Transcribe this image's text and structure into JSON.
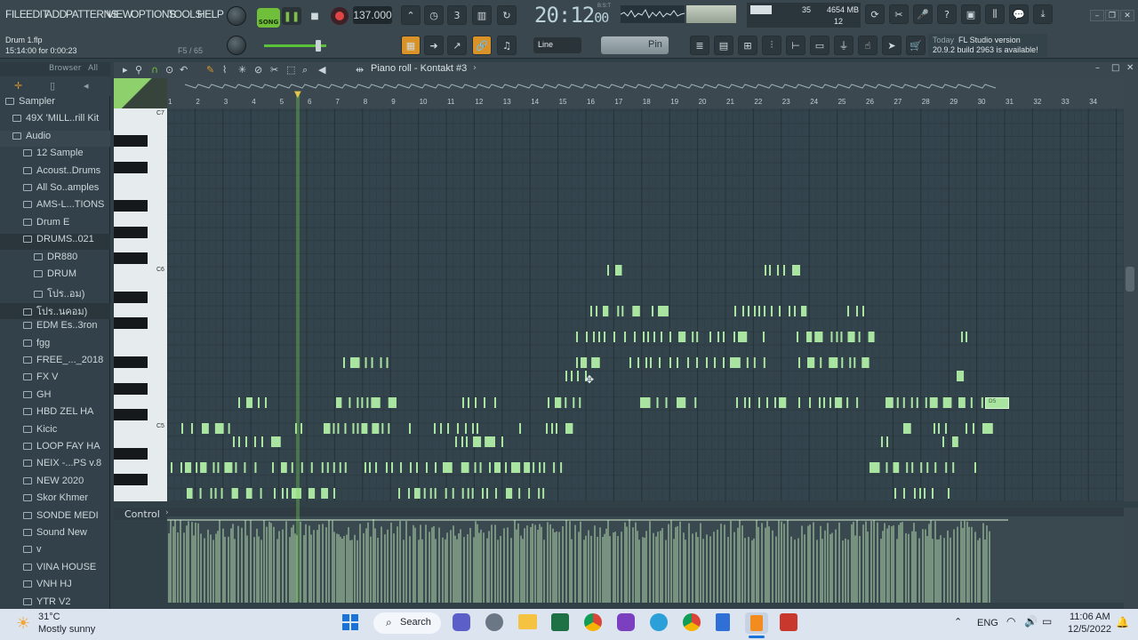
{
  "menu": [
    "FILE",
    "EDIT",
    "ADD",
    "PATTERNS",
    "VIEW",
    "OPTIONS",
    "TOOLS",
    "HELP"
  ],
  "project": {
    "file": "Drum 1.flp",
    "position": "15:14:00 for 0:00:23",
    "hint_right": "F5 / 65"
  },
  "transport": {
    "mode": "SONG",
    "tempo": "137.000",
    "clock": "20:12",
    "clock_small": "00",
    "clock_caption": "B:S:T"
  },
  "stats": {
    "memory": "4654 MB",
    "cpu_value": "35",
    "polyphony": "12"
  },
  "snap": {
    "tool_mode": "Line",
    "pin_label": "Pin"
  },
  "news": {
    "label": "Today",
    "line1": "FL Studio version",
    "line2": "20.9.2 build 2963 is available!"
  },
  "browser": {
    "header_label": "Browser",
    "header_filter": "All",
    "items": [
      {
        "label": "Sampler",
        "level": 0
      },
      {
        "label": "49X 'MILL..rill Kit",
        "level": 1
      },
      {
        "label": "Audio",
        "level": 1
      },
      {
        "label": "12 Sample",
        "level": 2
      },
      {
        "label": "Acoust..Drums",
        "level": 2
      },
      {
        "label": "All So..amples",
        "level": 2
      },
      {
        "label": "AMS-L...TIONS",
        "level": 2
      },
      {
        "label": "Drum E",
        "level": 2
      },
      {
        "label": "DRUMS..021",
        "level": 2
      },
      {
        "label": "DR880",
        "level": 3
      },
      {
        "label": "DRUM",
        "level": 3
      },
      {
        "label": "โปร..อม)",
        "level": 3
      },
      {
        "label": "โปร..นคอม)",
        "level": 2
      },
      {
        "label": "EDM Es..3ron",
        "level": 2
      },
      {
        "label": "fgg",
        "level": 2
      },
      {
        "label": "FREE_..._2018",
        "level": 2
      },
      {
        "label": "FX V",
        "level": 2
      },
      {
        "label": "GH",
        "level": 2
      },
      {
        "label": "HBD ZEL HA",
        "level": 2
      },
      {
        "label": "Kicic",
        "level": 2
      },
      {
        "label": "LOOP FAY HA",
        "level": 2
      },
      {
        "label": "NEIX -...PS v.8",
        "level": 2
      },
      {
        "label": "NEW 2020",
        "level": 2
      },
      {
        "label": "Skor Khmer",
        "level": 2
      },
      {
        "label": "SONDE MEDI",
        "level": 2
      },
      {
        "label": "Sound New",
        "level": 2
      },
      {
        "label": "v",
        "level": 2
      },
      {
        "label": "VINA HOUSE",
        "level": 2
      },
      {
        "label": "VNH HJ",
        "level": 2
      },
      {
        "label": "YTR V2",
        "level": 2
      }
    ]
  },
  "piano_roll": {
    "title": "Piano roll - Kontakt #3",
    "bar_numbers": [
      "1",
      "2",
      "3",
      "4",
      "5",
      "6",
      "7",
      "8",
      "9",
      "10",
      "11",
      "12",
      "13",
      "14",
      "15",
      "16",
      "17",
      "18",
      "19",
      "20",
      "21",
      "22",
      "23",
      "24",
      "25",
      "26",
      "27",
      "28",
      "29",
      "30",
      "31",
      "32",
      "33",
      "34"
    ],
    "octave_labels": [
      "C7",
      "C6",
      "C5"
    ],
    "selected_note_label": "D5",
    "control_label": "Control"
  },
  "taskbar": {
    "weather_temp": "31°C",
    "weather_desc": "Mostly sunny",
    "search_label": "Search",
    "language": "ENG",
    "time": "11:06 AM",
    "date": "12/5/2022"
  },
  "colors": {
    "accent_green": "#6fbf3a",
    "note_color": "#a9e4a0",
    "grid_bg": "#34444c",
    "taskbar_bg": "#dce4f0"
  }
}
